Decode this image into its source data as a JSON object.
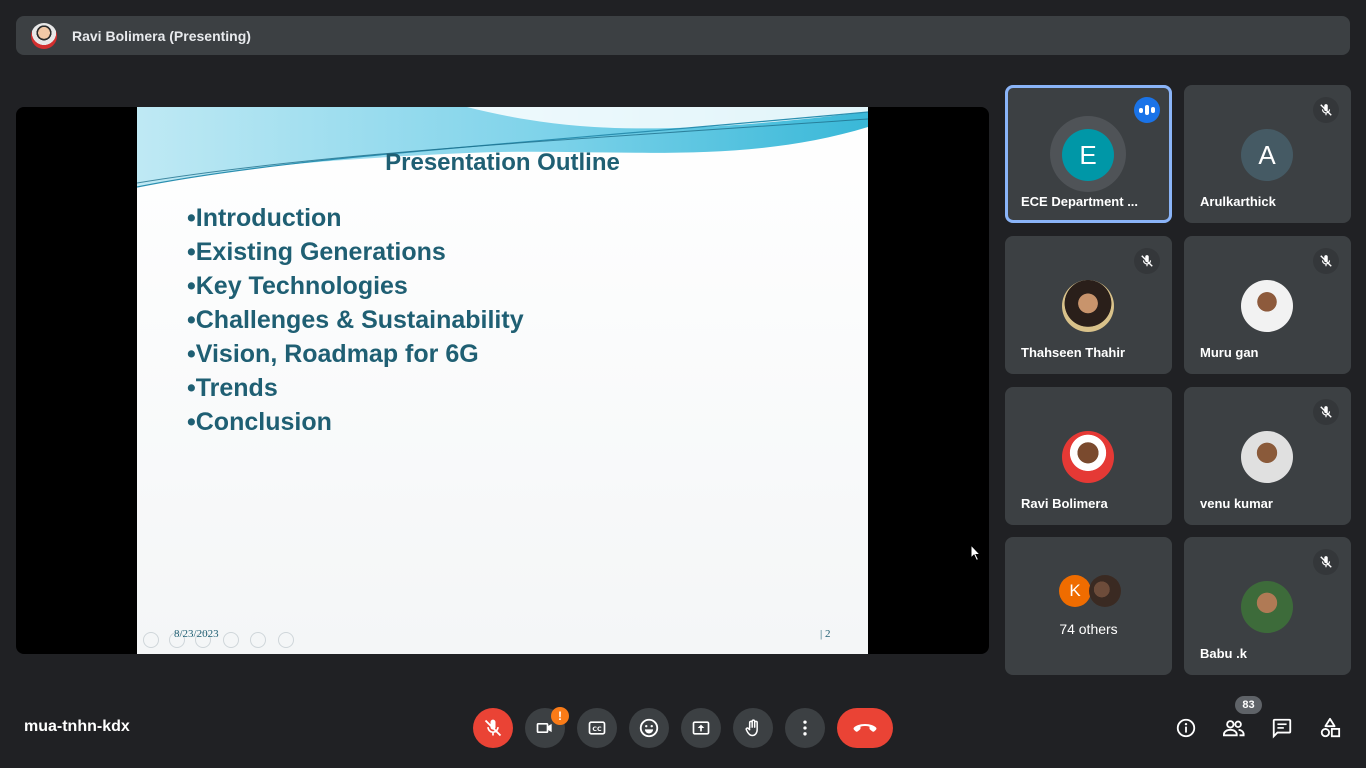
{
  "banner": {
    "presenter_title": "Ravi Bolimera (Presenting)"
  },
  "slide": {
    "title": "Presentation Outline",
    "bullets": [
      "•Introduction",
      "•Existing Generations",
      "•Key Technologies",
      "•Challenges & Sustainability",
      "•Vision, Roadmap for 6G",
      "•Trends",
      "•Conclusion"
    ],
    "date": "8/23/2023",
    "page": "| 2"
  },
  "tiles": [
    {
      "name": "ECE Department ...",
      "avatar_letter": "E",
      "avatar_color": "#0097a7",
      "status": "speaking"
    },
    {
      "name": "Arulkarthick",
      "avatar_letter": "A",
      "avatar_color": "#455a64",
      "status": "muted"
    },
    {
      "name": "Thahseen Thahir",
      "status": "muted"
    },
    {
      "name": "Muru gan",
      "status": "muted"
    },
    {
      "name": "Ravi Bolimera",
      "status": "unmuted"
    },
    {
      "name": "venu kumar",
      "status": "muted"
    },
    {
      "name": "74 others",
      "avatar_letter": "K",
      "avatar_color": "#ef6c00"
    },
    {
      "name": "Babu .k",
      "status": "muted"
    }
  ],
  "bottom_bar": {
    "meeting_code": "mua-tnhn-kdx",
    "camera_warning": "!",
    "participant_count": "83"
  },
  "colors": {
    "accent": "#8ab4f8",
    "danger": "#ea4335",
    "speaking": "#1a73e8",
    "warning": "#fa7b17"
  }
}
